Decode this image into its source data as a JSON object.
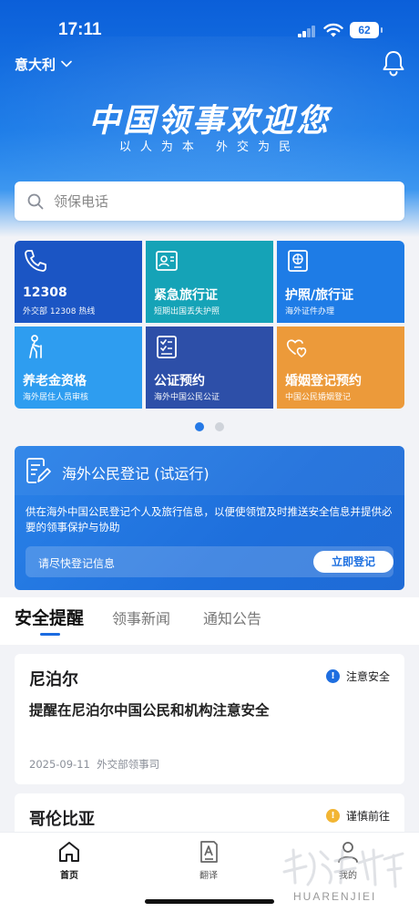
{
  "status_bar": {
    "time": "17:11",
    "battery": "62"
  },
  "header": {
    "country": "意大利",
    "title": "中国领事欢迎您",
    "subtitle": "以人为本  外交为民"
  },
  "search": {
    "placeholder": "领保电话"
  },
  "services": [
    {
      "title": "12308",
      "subtitle": "外交部 12308 热线",
      "icon": "phone-icon"
    },
    {
      "title": "紧急旅行证",
      "subtitle": "短期出国丢失护照",
      "icon": "id-card-icon"
    },
    {
      "title": "护照/旅行证",
      "subtitle": "海外证件办理",
      "icon": "passport-icon"
    },
    {
      "title": "养老金资格",
      "subtitle": "海外居住人员审核",
      "icon": "elder-icon"
    },
    {
      "title": "公证预约",
      "subtitle": "海外中国公民公证",
      "icon": "checklist-icon"
    },
    {
      "title": "婚姻登记预约",
      "subtitle": "中国公民婚姻登记",
      "icon": "hearts-icon"
    }
  ],
  "pager": {
    "pages": 2,
    "active": 1
  },
  "register": {
    "title": "海外公民登记 (试运行)",
    "description": "供在海外中国公民登记个人及旅行信息，以便使领馆及时推送安全信息并提供必要的领事保护与协助",
    "prompt": "请尽快登记信息",
    "button": "立即登记"
  },
  "tabs": [
    {
      "label": "安全提醒",
      "active": true
    },
    {
      "label": "领事新闻",
      "active": false
    },
    {
      "label": "通知公告",
      "active": false
    }
  ],
  "news": [
    {
      "country": "尼泊尔",
      "badge": "注意安全",
      "badge_color": "#1e6ee0",
      "headline": "提醒在尼泊尔中国公民和机构注意安全",
      "date": "2025-09-11",
      "source": "外交部领事司"
    },
    {
      "country": "哥伦比亚",
      "badge": "谨慎前往",
      "badge_color": "#f2b533"
    }
  ],
  "bottom_nav": [
    {
      "label": "首页",
      "icon": "home-icon",
      "active": true
    },
    {
      "label": "翻译",
      "icon": "translate-icon",
      "active": false
    },
    {
      "label": "我的",
      "icon": "person-icon",
      "active": false
    }
  ],
  "watermark": {
    "text": "HUARENJIEI"
  }
}
